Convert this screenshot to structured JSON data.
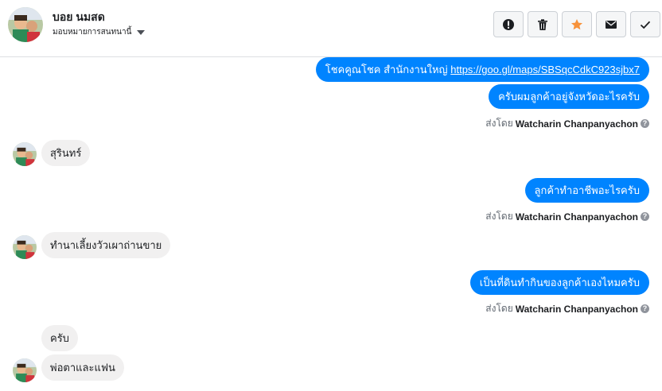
{
  "header": {
    "contact_name": "บอย นมสด",
    "assign_label": "มอบหมายการสนทนานี้"
  },
  "actions": [
    {
      "name": "spam-button",
      "icon": "alert-icon"
    },
    {
      "name": "delete-button",
      "icon": "trash-icon"
    },
    {
      "name": "star-button",
      "icon": "star-icon",
      "color": "#f7923b"
    },
    {
      "name": "mark-unread-button",
      "icon": "envelope-icon"
    },
    {
      "name": "mark-done-button",
      "icon": "check-icon"
    }
  ],
  "messages": {
    "m1": {
      "prefix": "โชคคูณโชค สำนักงานใหญ่ ",
      "link": "https://goo.gl/maps/SBSqcCdkC923sjbx7"
    },
    "m2": {
      "text": "ครับผมลูกค้าอยู่จังหวัดอะไรครับ"
    },
    "m2_sent": {
      "label": "ส่งโดย",
      "agent": "Watcharin Chanpanyachon"
    },
    "m3": {
      "text": "สุรินทร์"
    },
    "m4": {
      "text": "ลูกค้าทำอาชีพอะไรครับ"
    },
    "m4_sent": {
      "label": "ส่งโดย",
      "agent": "Watcharin Chanpanyachon"
    },
    "m5": {
      "text": "ทำนาเลี้ยงวัวเผาถ่านขาย"
    },
    "m6": {
      "text": "เป็นที่ดินทำกินของลูกค้าเองไหมครับ"
    },
    "m6_sent": {
      "label": "ส่งโดย",
      "agent": "Watcharin Chanpanyachon"
    },
    "m7": {
      "text": "ครับ"
    },
    "m8": {
      "text": "พ่อตาและแฟน"
    }
  },
  "colors": {
    "outgoing_bubble": "#0084ff",
    "incoming_bubble": "#f1f0f0",
    "star": "#f7923b"
  }
}
